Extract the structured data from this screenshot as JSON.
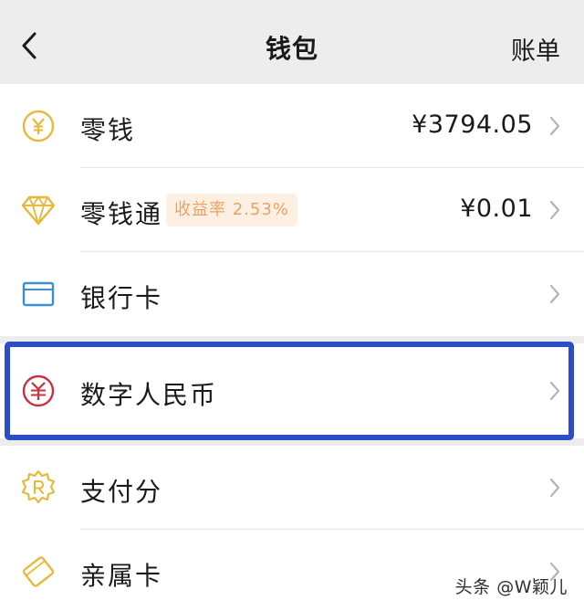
{
  "header": {
    "title": "钱包",
    "bill_label": "账单"
  },
  "rows": {
    "change": {
      "label": "零钱",
      "value": "¥3794.05"
    },
    "change_pass": {
      "label": "零钱通",
      "badge": "收益率 2.53%",
      "value": "¥0.01"
    },
    "bank_card": {
      "label": "银行卡"
    },
    "digital_rmb": {
      "label": "数字人民币"
    },
    "pay_score": {
      "label": "支付分"
    },
    "family_card": {
      "label": "亲属卡"
    }
  },
  "watermark": "头条 @W颖儿",
  "colors": {
    "accent_gold": "#e6b93a",
    "bank_blue": "#3c8fd0",
    "rmb_red": "#c8323e",
    "highlight_blue": "#2b4ec6",
    "badge_text": "#e8a366"
  },
  "icons": {
    "change": "yen-circle-icon",
    "change_pass": "diamond-icon",
    "bank_card": "card-icon",
    "digital_rmb": "digital-rmb-icon",
    "pay_score": "badge-score-icon",
    "family_card": "family-card-icon"
  }
}
